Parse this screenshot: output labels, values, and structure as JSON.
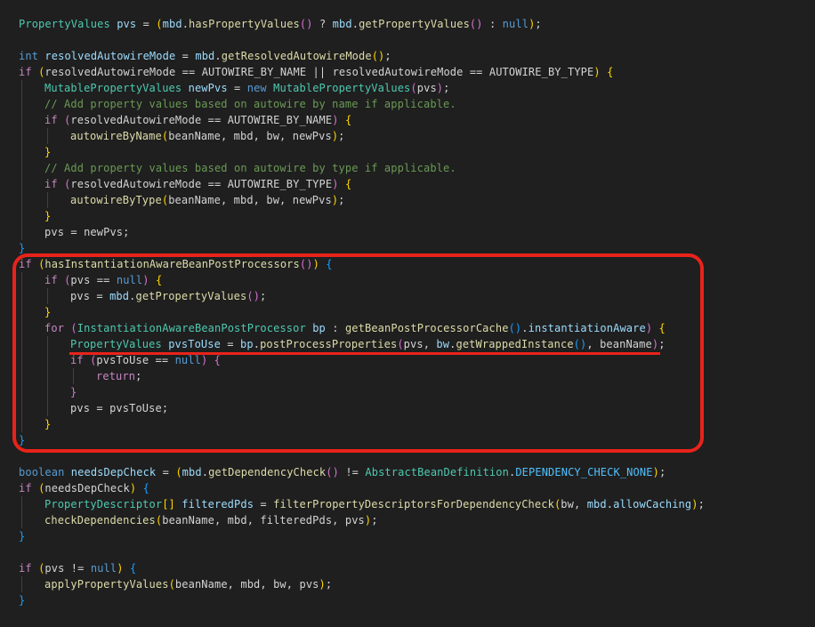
{
  "colors": {
    "background": "#1f1f1f",
    "annotation": "#e8231b",
    "keyword": "#569cd6",
    "control": "#c586c0",
    "type": "#4ec9b0",
    "function": "#dcdcaa",
    "variable": "#9cdcfe",
    "comment": "#6a9955"
  },
  "code_lines": [
    {
      "indent": 0,
      "tokens": [
        [
          "PropertyValues",
          "type"
        ],
        [
          " ",
          "text"
        ],
        [
          "pvs",
          "var"
        ],
        [
          " = ",
          "text"
        ],
        [
          "(",
          "b1"
        ],
        [
          "mbd",
          "var"
        ],
        [
          ".",
          "text"
        ],
        [
          "hasPropertyValues",
          "fn"
        ],
        [
          "()",
          "b2"
        ],
        [
          " ? ",
          "text"
        ],
        [
          "mbd",
          "var"
        ],
        [
          ".",
          "text"
        ],
        [
          "getPropertyValues",
          "fn"
        ],
        [
          "()",
          "b2"
        ],
        [
          " : ",
          "text"
        ],
        [
          "null",
          "kw"
        ],
        [
          ")",
          "b1"
        ],
        [
          ";",
          "text"
        ]
      ]
    },
    {
      "indent": 0,
      "tokens": []
    },
    {
      "indent": 0,
      "tokens": [
        [
          "int",
          "kw"
        ],
        [
          " ",
          "text"
        ],
        [
          "resolvedAutowireMode",
          "var"
        ],
        [
          " = ",
          "text"
        ],
        [
          "mbd",
          "var"
        ],
        [
          ".",
          "text"
        ],
        [
          "getResolvedAutowireMode",
          "fn"
        ],
        [
          "()",
          "b1"
        ],
        [
          ";",
          "text"
        ]
      ]
    },
    {
      "indent": 0,
      "tokens": [
        [
          "if",
          "ctrl"
        ],
        [
          " ",
          "text"
        ],
        [
          "(",
          "b1"
        ],
        [
          "resolvedAutowireMode == AUTOWIRE_BY_NAME || resolvedAutowireMode == AUTOWIRE_BY_TYPE",
          "text"
        ],
        [
          ")",
          "b1"
        ],
        [
          " ",
          "text"
        ],
        [
          "{",
          "b1"
        ]
      ]
    },
    {
      "indent": 1,
      "tokens": [
        [
          "MutablePropertyValues",
          "type"
        ],
        [
          " ",
          "text"
        ],
        [
          "newPvs",
          "var"
        ],
        [
          " = ",
          "text"
        ],
        [
          "new",
          "kw"
        ],
        [
          " ",
          "text"
        ],
        [
          "MutablePropertyValues",
          "type"
        ],
        [
          "(",
          "b2"
        ],
        [
          "pvs",
          "text"
        ],
        [
          ")",
          "b2"
        ],
        [
          ";",
          "text"
        ]
      ]
    },
    {
      "indent": 1,
      "tokens": [
        [
          "// Add property values based on autowire by name if applicable.",
          "com"
        ]
      ]
    },
    {
      "indent": 1,
      "tokens": [
        [
          "if",
          "ctrl"
        ],
        [
          " ",
          "text"
        ],
        [
          "(",
          "b2"
        ],
        [
          "resolvedAutowireMode == AUTOWIRE_BY_NAME",
          "text"
        ],
        [
          ")",
          "b2"
        ],
        [
          " ",
          "text"
        ],
        [
          "{",
          "b1"
        ]
      ]
    },
    {
      "indent": 2,
      "tokens": [
        [
          "autowireByName",
          "fn"
        ],
        [
          "(",
          "b1"
        ],
        [
          "beanName, mbd, bw, newPvs",
          "text"
        ],
        [
          ")",
          "b1"
        ],
        [
          ";",
          "text"
        ]
      ]
    },
    {
      "indent": 1,
      "tokens": [
        [
          "}",
          "b1"
        ]
      ]
    },
    {
      "indent": 1,
      "tokens": [
        [
          "// Add property values based on autowire by type if applicable.",
          "com"
        ]
      ]
    },
    {
      "indent": 1,
      "tokens": [
        [
          "if",
          "ctrl"
        ],
        [
          " ",
          "text"
        ],
        [
          "(",
          "b2"
        ],
        [
          "resolvedAutowireMode == AUTOWIRE_BY_TYPE",
          "text"
        ],
        [
          ")",
          "b2"
        ],
        [
          " ",
          "text"
        ],
        [
          "{",
          "b1"
        ]
      ]
    },
    {
      "indent": 2,
      "tokens": [
        [
          "autowireByType",
          "fn"
        ],
        [
          "(",
          "b1"
        ],
        [
          "beanName, mbd, bw, newPvs",
          "text"
        ],
        [
          ")",
          "b1"
        ],
        [
          ";",
          "text"
        ]
      ]
    },
    {
      "indent": 1,
      "tokens": [
        [
          "}",
          "b1"
        ]
      ]
    },
    {
      "indent": 1,
      "tokens": [
        [
          "pvs = newPvs;",
          "text"
        ]
      ]
    },
    {
      "indent": 0,
      "tokens": [
        [
          "}",
          "b3"
        ]
      ]
    },
    {
      "indent": 0,
      "tokens": [
        [
          "if",
          "ctrl"
        ],
        [
          " ",
          "text"
        ],
        [
          "(",
          "b1"
        ],
        [
          "hasInstantiationAwareBeanPostProcessors",
          "fn"
        ],
        [
          "()",
          "b2"
        ],
        [
          ")",
          "b1"
        ],
        [
          " ",
          "text"
        ],
        [
          "{",
          "b3"
        ]
      ]
    },
    {
      "indent": 1,
      "tokens": [
        [
          "if",
          "ctrl"
        ],
        [
          " ",
          "text"
        ],
        [
          "(",
          "b2"
        ],
        [
          "pvs == ",
          "text"
        ],
        [
          "null",
          "kw"
        ],
        [
          ")",
          "b2"
        ],
        [
          " ",
          "text"
        ],
        [
          "{",
          "b1"
        ]
      ]
    },
    {
      "indent": 2,
      "tokens": [
        [
          "pvs = ",
          "text"
        ],
        [
          "mbd",
          "var"
        ],
        [
          ".",
          "text"
        ],
        [
          "getPropertyValues",
          "fn"
        ],
        [
          "()",
          "b2"
        ],
        [
          ";",
          "text"
        ]
      ]
    },
    {
      "indent": 1,
      "tokens": [
        [
          "}",
          "b1"
        ]
      ]
    },
    {
      "indent": 1,
      "tokens": [
        [
          "for",
          "ctrl"
        ],
        [
          " ",
          "text"
        ],
        [
          "(",
          "b2"
        ],
        [
          "InstantiationAwareBeanPostProcessor",
          "type"
        ],
        [
          " ",
          "text"
        ],
        [
          "bp",
          "var"
        ],
        [
          " : ",
          "text"
        ],
        [
          "getBeanPostProcessorCache",
          "fn"
        ],
        [
          "()",
          "b3"
        ],
        [
          ".",
          "text"
        ],
        [
          "instantiationAware",
          "var"
        ],
        [
          ")",
          "b2"
        ],
        [
          " ",
          "text"
        ],
        [
          "{",
          "b1"
        ]
      ]
    },
    {
      "indent": 2,
      "tokens": [
        [
          "PropertyValues",
          "type"
        ],
        [
          " ",
          "text"
        ],
        [
          "pvsToUse",
          "var"
        ],
        [
          " = ",
          "text"
        ],
        [
          "bp",
          "var"
        ],
        [
          ".",
          "text"
        ],
        [
          "postProcessProperties",
          "fn"
        ],
        [
          "(",
          "b2"
        ],
        [
          "pvs, ",
          "text"
        ],
        [
          "bw",
          "var"
        ],
        [
          ".",
          "text"
        ],
        [
          "getWrappedInstance",
          "fn"
        ],
        [
          "()",
          "b3"
        ],
        [
          ", beanName",
          "text"
        ],
        [
          ")",
          "b2"
        ],
        [
          ";",
          "text"
        ]
      ]
    },
    {
      "indent": 2,
      "tokens": [
        [
          "if",
          "ctrl"
        ],
        [
          " ",
          "text"
        ],
        [
          "(",
          "b2"
        ],
        [
          "pvsToUse == ",
          "text"
        ],
        [
          "null",
          "kw"
        ],
        [
          ")",
          "b2"
        ],
        [
          " ",
          "text"
        ],
        [
          "{",
          "b2"
        ]
      ]
    },
    {
      "indent": 3,
      "tokens": [
        [
          "return",
          "ctrl"
        ],
        [
          ";",
          "text"
        ]
      ]
    },
    {
      "indent": 2,
      "tokens": [
        [
          "}",
          "b2"
        ]
      ]
    },
    {
      "indent": 2,
      "tokens": [
        [
          "pvs = pvsToUse;",
          "text"
        ]
      ]
    },
    {
      "indent": 1,
      "tokens": [
        [
          "}",
          "b1"
        ]
      ]
    },
    {
      "indent": 0,
      "tokens": [
        [
          "}",
          "b3"
        ]
      ]
    },
    {
      "indent": 0,
      "tokens": []
    },
    {
      "indent": 0,
      "tokens": [
        [
          "boolean",
          "kw"
        ],
        [
          " ",
          "text"
        ],
        [
          "needsDepCheck",
          "var"
        ],
        [
          " = ",
          "text"
        ],
        [
          "(",
          "b1"
        ],
        [
          "mbd",
          "var"
        ],
        [
          ".",
          "text"
        ],
        [
          "getDependencyCheck",
          "fn"
        ],
        [
          "()",
          "b2"
        ],
        [
          " != ",
          "text"
        ],
        [
          "AbstractBeanDefinition",
          "type"
        ],
        [
          ".",
          "text"
        ],
        [
          "DEPENDENCY_CHECK_NONE",
          "const"
        ],
        [
          ")",
          "b1"
        ],
        [
          ";",
          "text"
        ]
      ]
    },
    {
      "indent": 0,
      "tokens": [
        [
          "if",
          "ctrl"
        ],
        [
          " ",
          "text"
        ],
        [
          "(",
          "b1"
        ],
        [
          "needsDepCheck",
          "text"
        ],
        [
          ")",
          "b1"
        ],
        [
          " ",
          "text"
        ],
        [
          "{",
          "b3"
        ]
      ]
    },
    {
      "indent": 1,
      "tokens": [
        [
          "PropertyDescriptor",
          "type"
        ],
        [
          "[]",
          "b1"
        ],
        [
          " ",
          "text"
        ],
        [
          "filteredPds",
          "var"
        ],
        [
          " = ",
          "text"
        ],
        [
          "filterPropertyDescriptorsForDependencyCheck",
          "fn"
        ],
        [
          "(",
          "b1"
        ],
        [
          "bw, ",
          "text"
        ],
        [
          "mbd",
          "var"
        ],
        [
          ".",
          "text"
        ],
        [
          "allowCaching",
          "var"
        ],
        [
          ")",
          "b1"
        ],
        [
          ";",
          "text"
        ]
      ]
    },
    {
      "indent": 1,
      "tokens": [
        [
          "checkDependencies",
          "fn"
        ],
        [
          "(",
          "b1"
        ],
        [
          "beanName, mbd, filteredPds, pvs",
          "text"
        ],
        [
          ")",
          "b1"
        ],
        [
          ";",
          "text"
        ]
      ]
    },
    {
      "indent": 0,
      "tokens": [
        [
          "}",
          "b3"
        ]
      ]
    },
    {
      "indent": 0,
      "tokens": []
    },
    {
      "indent": 0,
      "tokens": [
        [
          "if",
          "ctrl"
        ],
        [
          " ",
          "text"
        ],
        [
          "(",
          "b1"
        ],
        [
          "pvs != ",
          "text"
        ],
        [
          "null",
          "kw"
        ],
        [
          ")",
          "b1"
        ],
        [
          " ",
          "text"
        ],
        [
          "{",
          "b3"
        ]
      ]
    },
    {
      "indent": 1,
      "tokens": [
        [
          "applyPropertyValues",
          "fn"
        ],
        [
          "(",
          "b1"
        ],
        [
          "beanName, mbd, bw, pvs",
          "text"
        ],
        [
          ")",
          "b1"
        ],
        [
          ";",
          "text"
        ]
      ]
    },
    {
      "indent": 0,
      "tokens": [
        [
          "}",
          "b3"
        ]
      ]
    }
  ]
}
